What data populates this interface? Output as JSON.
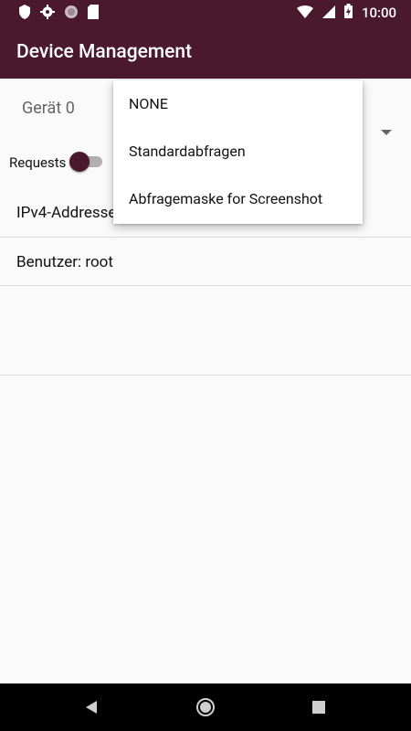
{
  "status_bar": {
    "time": "10:00",
    "icons_left": [
      "shield-icon",
      "gear-icon",
      "circle-icon",
      "sd-card-icon"
    ],
    "icons_right": [
      "wifi-icon",
      "signal-icon",
      "battery-icon"
    ]
  },
  "app_bar": {
    "title": "Device Management"
  },
  "device": {
    "name": "Gerät 0"
  },
  "requests": {
    "label": "Requests",
    "switch_on": true
  },
  "fields": {
    "ipv4_label": "IPv4-Addresse",
    "user_label": "Benutzer:",
    "user_value": "root"
  },
  "dropdown": {
    "items": [
      "NONE",
      "Standardabfragen",
      "Abfragemaske for Screenshot"
    ]
  },
  "colors": {
    "primary": "#4a1a2c",
    "background": "#fafafa",
    "nav_bar": "#000000"
  }
}
